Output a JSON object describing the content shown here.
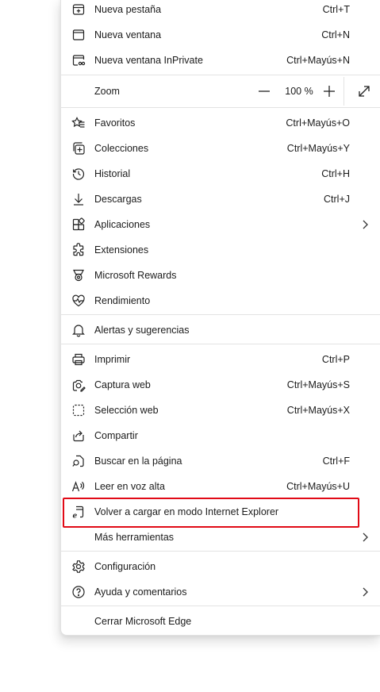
{
  "menu": {
    "group1": [
      {
        "label": "Nueva pestaña",
        "shortcut": "Ctrl+T",
        "icon": "new-tab-icon"
      },
      {
        "label": "Nueva ventana",
        "shortcut": "Ctrl+N",
        "icon": "new-window-icon"
      },
      {
        "label": "Nueva ventana InPrivate",
        "shortcut": "Ctrl+Mayús+N",
        "icon": "inprivate-window-icon"
      }
    ],
    "zoom": {
      "label": "Zoom",
      "value": "100 %",
      "minus": "zoom-out-icon",
      "plus": "zoom-in-icon",
      "fullscreen": "fullscreen-icon"
    },
    "group2": [
      {
        "label": "Favoritos",
        "shortcut": "Ctrl+Mayús+O",
        "icon": "favorites-icon"
      },
      {
        "label": "Colecciones",
        "shortcut": "Ctrl+Mayús+Y",
        "icon": "collections-icon"
      },
      {
        "label": "Historial",
        "shortcut": "Ctrl+H",
        "icon": "history-icon"
      },
      {
        "label": "Descargas",
        "shortcut": "Ctrl+J",
        "icon": "downloads-icon"
      },
      {
        "label": "Aplicaciones",
        "shortcut": "",
        "icon": "apps-icon"
      },
      {
        "label": "Extensiones",
        "shortcut": "",
        "icon": "extensions-icon"
      },
      {
        "label": "Microsoft Rewards",
        "shortcut": "",
        "icon": "rewards-icon"
      },
      {
        "label": "Rendimiento",
        "shortcut": "",
        "icon": "performance-icon"
      }
    ],
    "group3": [
      {
        "label": "Alertas y sugerencias",
        "shortcut": "",
        "icon": "bell-icon"
      }
    ],
    "group4": [
      {
        "label": "Imprimir",
        "shortcut": "Ctrl+P",
        "icon": "print-icon"
      },
      {
        "label": "Captura web",
        "shortcut": "Ctrl+Mayús+S",
        "icon": "web-capture-icon"
      },
      {
        "label": "Selección web",
        "shortcut": "Ctrl+Mayús+X",
        "icon": "web-select-icon"
      },
      {
        "label": "Compartir",
        "shortcut": "",
        "icon": "share-icon"
      },
      {
        "label": "Buscar en la página",
        "shortcut": "Ctrl+F",
        "icon": "find-in-page-icon"
      },
      {
        "label": "Leer en voz alta",
        "shortcut": "Ctrl+Mayús+U",
        "icon": "read-aloud-icon"
      },
      {
        "label": "Volver a cargar en modo Internet Explorer",
        "shortcut": "",
        "icon": "ie-mode-icon"
      },
      {
        "label": "Más herramientas",
        "shortcut": "",
        "icon": ""
      }
    ],
    "group5": [
      {
        "label": "Configuración",
        "shortcut": "",
        "icon": "settings-icon"
      },
      {
        "label": "Ayuda y comentarios",
        "shortcut": "",
        "icon": "help-icon"
      }
    ],
    "group6": [
      {
        "label": "Cerrar Microsoft Edge",
        "shortcut": "",
        "icon": ""
      }
    ]
  },
  "colors": {
    "highlight": "#e10a16",
    "separator": "#e3e3e3",
    "text": "#1b1b1b"
  }
}
